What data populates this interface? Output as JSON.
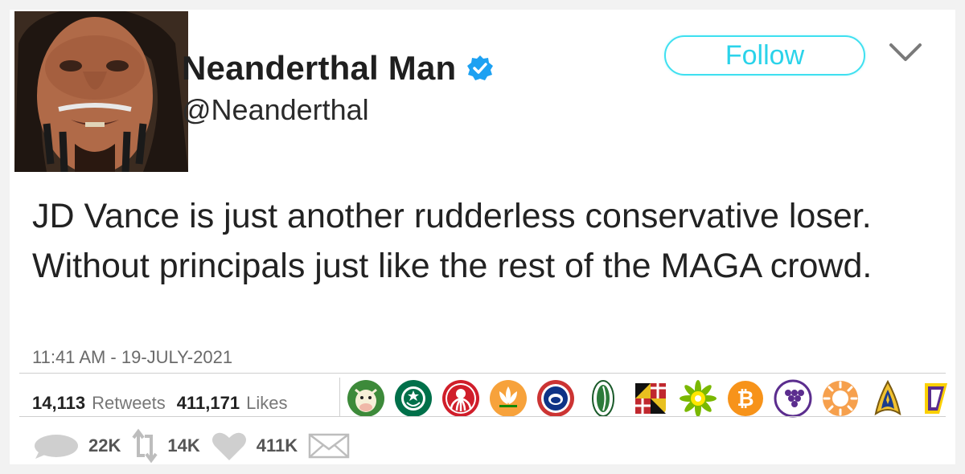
{
  "user": {
    "display_name": "Neanderthal Man",
    "handle": "@Neanderthal",
    "verified": true
  },
  "follow_label": "Follow",
  "tweet": {
    "text": "JD Vance is just another rudderless conservative loser. Without principals just like the rest of the MAGA crowd.",
    "timestamp": "11:41 AM - 19-JULY-2021"
  },
  "stats": {
    "retweets_count": "14,113",
    "retweets_label": "Retweets",
    "likes_count": "411,171",
    "likes_label": "Likes"
  },
  "likers": [
    "cow-logo-icon",
    "starbucks-logo-icon",
    "hydra-logo-icon",
    "lotus-logo-icon",
    "cubs-logo-icon",
    "seed-logo-icon",
    "maryland-flag-icon",
    "bp-logo-icon",
    "bitcoin-logo-icon",
    "grapes-logo-icon",
    "sun-logo-icon",
    "starfleet-logo-icon",
    "flag-logo-icon"
  ],
  "actions": {
    "reply_count": "22K",
    "retweet_count": "14K",
    "like_count": "411K"
  },
  "colors": {
    "follow_accent": "#2bd3ea",
    "verified_blue": "#1da1f2",
    "text_gray": "#777777"
  }
}
